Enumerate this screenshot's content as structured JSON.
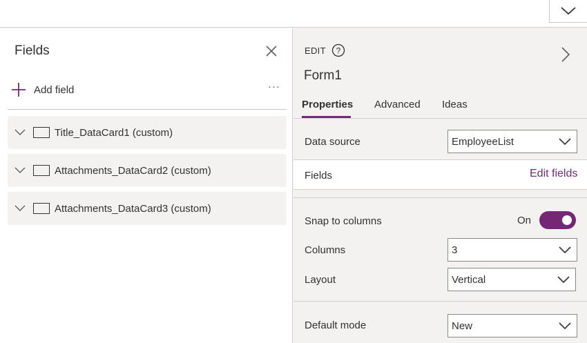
{
  "colors": {
    "accent": "#742774",
    "panel_bg": "#f3f2f1",
    "card_bg": "#f3f2f1",
    "text": "#323130"
  },
  "fields_panel": {
    "title": "Fields",
    "add_field_label": "Add field",
    "more_label": "···",
    "cards": [
      {
        "label": "Title_DataCard1 (custom)"
      },
      {
        "label": "Attachments_DataCard2 (custom)"
      },
      {
        "label": "Attachments_DataCard3 (custom)"
      }
    ]
  },
  "props_panel": {
    "mode_label": "EDIT",
    "control_name": "Form1",
    "tabs": [
      {
        "label": "Properties",
        "active": true
      },
      {
        "label": "Advanced",
        "active": false
      },
      {
        "label": "Ideas",
        "active": false
      }
    ],
    "data_source": {
      "label": "Data source",
      "value": "EmployeeList"
    },
    "fields": {
      "label": "Fields",
      "link": "Edit fields"
    },
    "snap": {
      "label": "Snap to columns",
      "state": "On",
      "on": true
    },
    "columns": {
      "label": "Columns",
      "value": "3"
    },
    "layout": {
      "label": "Layout",
      "value": "Vertical"
    },
    "default_mode": {
      "label": "Default mode",
      "value": "New"
    }
  }
}
